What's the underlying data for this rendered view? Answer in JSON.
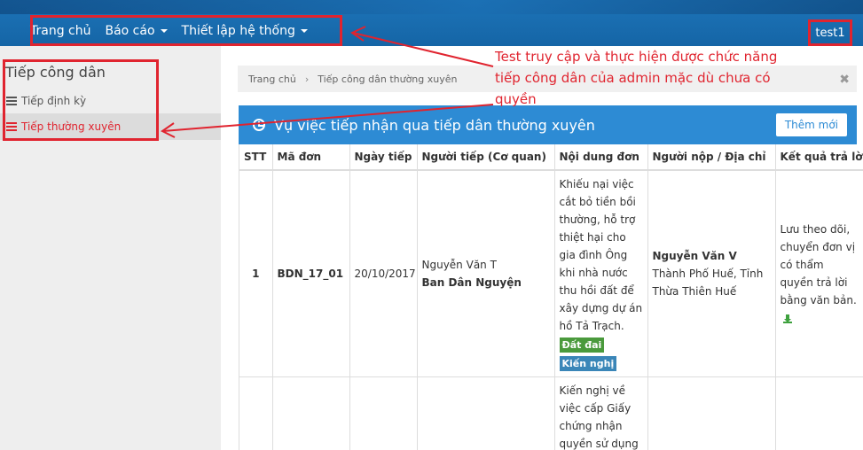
{
  "nav": {
    "items": [
      {
        "label": "Trang chủ",
        "has_caret": false
      },
      {
        "label": "Báo cáo",
        "has_caret": true
      },
      {
        "label": "Thiết lập hệ thống",
        "has_caret": true
      }
    ],
    "user": "test1"
  },
  "sidebar": {
    "title": "Tiếp công dân",
    "items": [
      {
        "label": "Tiếp định kỳ",
        "icon": "list-icon",
        "active": false
      },
      {
        "label": "Tiếp thường xuyên",
        "icon": "list-icon",
        "active": true
      }
    ]
  },
  "breadcrumb": {
    "home": "Trang chủ",
    "separator": "›",
    "current": "Tiếp công dân thường xuyên",
    "close": "✖"
  },
  "annotation": {
    "text": "Test truy cập và thực hiện được chức năng tiếp công dân của admin mặc dù chưa có quyền",
    "color": "#e0242f"
  },
  "panel": {
    "title": "Vụ việc tiếp nhận qua tiếp dân thường xuyên",
    "add_button": "Thêm mới",
    "color": "#2d8bd4"
  },
  "table": {
    "headers": [
      "STT",
      "Mã đơn",
      "Ngày tiếp",
      "Người tiếp (Cơ quan)",
      "Nội dung đơn",
      "Người nộp / Địa chỉ",
      "Kết quả trả lời"
    ],
    "rows": [
      {
        "stt": "1",
        "ma_don": "BDN_17_01",
        "ngay_tiep": "20/10/2017",
        "nguoi_tiep": "Nguyễn Văn T",
        "co_quan": "Ban Dân Nguyện",
        "noi_dung": "Khiếu nại việc cắt bỏ tiền bồi thường, hỗ trợ thiệt hại cho gia đình Ông khi nhà nước thu hồi đất để xây dựng dự án hồ Tả Trạch.",
        "tags": [
          "Đất đai",
          "Kiến nghị"
        ],
        "nguoi_nop": "Nguyễn Văn V",
        "dia_chi": "Thành Phố Huế, Tỉnh Thừa Thiên Huế",
        "ket_qua": "Lưu theo dõi, chuyển đơn vị có thẩm quyền trả lời bằng văn bản."
      },
      {
        "stt": "",
        "ma_don": "",
        "ngay_tiep": "",
        "nguoi_tiep": "",
        "co_quan": "",
        "noi_dung": "Kiến nghị về việc cấp Giấy chứng nhận quyền sử dụng",
        "tags": [],
        "nguoi_nop": "",
        "dia_chi": "",
        "ket_qua": ""
      }
    ]
  }
}
